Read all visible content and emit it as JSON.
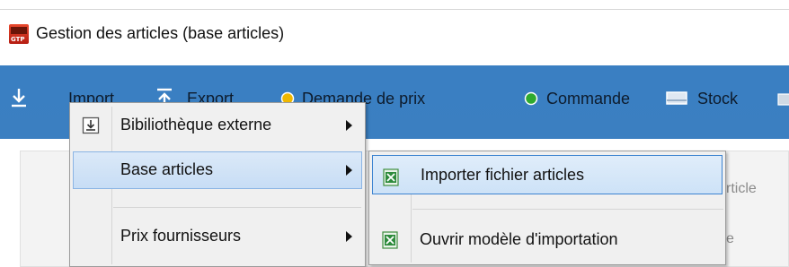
{
  "window": {
    "title": "Gestion des articles (base articles)",
    "app_icon_text": "GTP"
  },
  "toolbar": {
    "import_label": "Import",
    "export_label": "Export",
    "price_request_label": "Demande de prix",
    "order_label": "Commande",
    "stock_label": "Stock",
    "colors": {
      "background": "#3a7fc2",
      "order_dot": "#2faa2f",
      "price_dot": "#f0b800"
    }
  },
  "background_panel": {
    "text_right_1": "rticle",
    "text_right_2": "e"
  },
  "import_menu": {
    "items": [
      {
        "label": "Bibiliothèque externe",
        "has_submenu": true,
        "icon": "import-icon"
      },
      {
        "label": "Base articles",
        "has_submenu": true,
        "highlighted": true
      },
      {
        "label": "Prix fournisseurs",
        "has_submenu": true
      }
    ]
  },
  "base_articles_submenu": {
    "items": [
      {
        "label": "Importer fichier articles",
        "icon": "excel-icon",
        "highlighted": true
      },
      {
        "label": "Ouvrir modèle d'importation",
        "icon": "excel-icon"
      }
    ]
  }
}
